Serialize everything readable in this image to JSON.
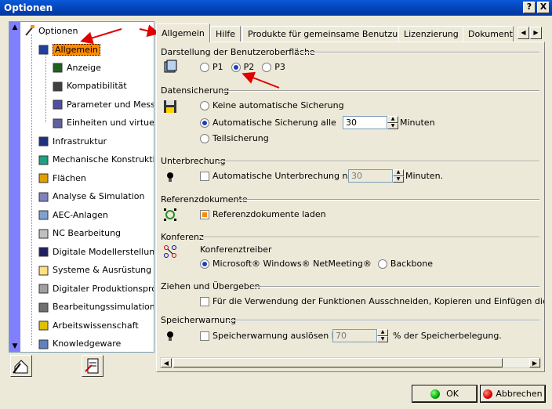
{
  "window": {
    "title": "Optionen",
    "help_label": "?",
    "close_label": "X"
  },
  "tree": {
    "root": "Optionen",
    "items": [
      {
        "label": "Allgemein",
        "level": 1,
        "selected": true
      },
      {
        "label": "Anzeige",
        "level": 2
      },
      {
        "label": "Kompatibilität",
        "level": 2
      },
      {
        "label": "Parameter und Messungen",
        "level": 2
      },
      {
        "label": "Einheiten und virtuelle Realität",
        "level": 2
      },
      {
        "label": "Infrastruktur",
        "level": 1
      },
      {
        "label": "Mechanische Konstruktion",
        "level": 1
      },
      {
        "label": "Flächen",
        "level": 1
      },
      {
        "label": "Analyse & Simulation",
        "level": 1
      },
      {
        "label": "AEC-Anlagen",
        "level": 1
      },
      {
        "label": "NC Bearbeitung",
        "level": 1
      },
      {
        "label": "Digitale Modellerstellung",
        "level": 1
      },
      {
        "label": "Systeme & Ausrüstung",
        "level": 1
      },
      {
        "label": "Digitaler Produktionsprozess",
        "level": 1
      },
      {
        "label": "Bearbeitungssimulation",
        "level": 1
      },
      {
        "label": "Arbeitswissenschaft",
        "level": 1
      },
      {
        "label": "Knowledgeware",
        "level": 1
      }
    ]
  },
  "tabs": [
    {
      "label": "Allgemein",
      "active": true
    },
    {
      "label": "Hilfe"
    },
    {
      "label": "Produkte für gemeinsame Benutzung"
    },
    {
      "label": "Lizenzierung"
    },
    {
      "label": "Dokument"
    }
  ],
  "sections": {
    "ui": {
      "title": "Darstellung der Benutzeroberfläche",
      "options": [
        "P1",
        "P2",
        "P3"
      ],
      "selected": "P2"
    },
    "backup": {
      "title": "Datensicherung",
      "none": "Keine automatische Sicherung",
      "auto": "Automatische Sicherung alle",
      "auto_value": "30",
      "auto_unit": "Minuten",
      "partial": "Teilsicherung",
      "selected": "auto"
    },
    "interrupt": {
      "title": "Unterbrechung",
      "label": "Automatische Unterbrechung nach",
      "value": "30",
      "unit": "Minuten.",
      "checked": false
    },
    "refdocs": {
      "title": "Referenzdokumente",
      "label": "Referenzdokumente laden",
      "checked": true
    },
    "conference": {
      "title": "Konferenz",
      "driver_label": "Konferenztreiber",
      "opt1": "Microsoft® Windows® NetMeeting®",
      "opt2": "Backbone",
      "selected": "opt1"
    },
    "dragdrop": {
      "title": "Ziehen und Übergeben",
      "label": "Für die Verwendung der Funktionen Ausschneiden, Kopieren und Einfügen die Option 'Z",
      "checked": false
    },
    "memory": {
      "title": "Speicherwarnung",
      "label": "Speicherwarnung auslösen bei",
      "value": "70",
      "unit": "% der Speicherbelegung.",
      "checked": false
    }
  },
  "buttons": {
    "ok": "OK",
    "cancel": "Abbrechen"
  },
  "colors": {
    "title_bar": "#0442b5",
    "selection": "#ff8c00",
    "arrow": "#e00000",
    "tree_scroll": "#8080ff"
  }
}
